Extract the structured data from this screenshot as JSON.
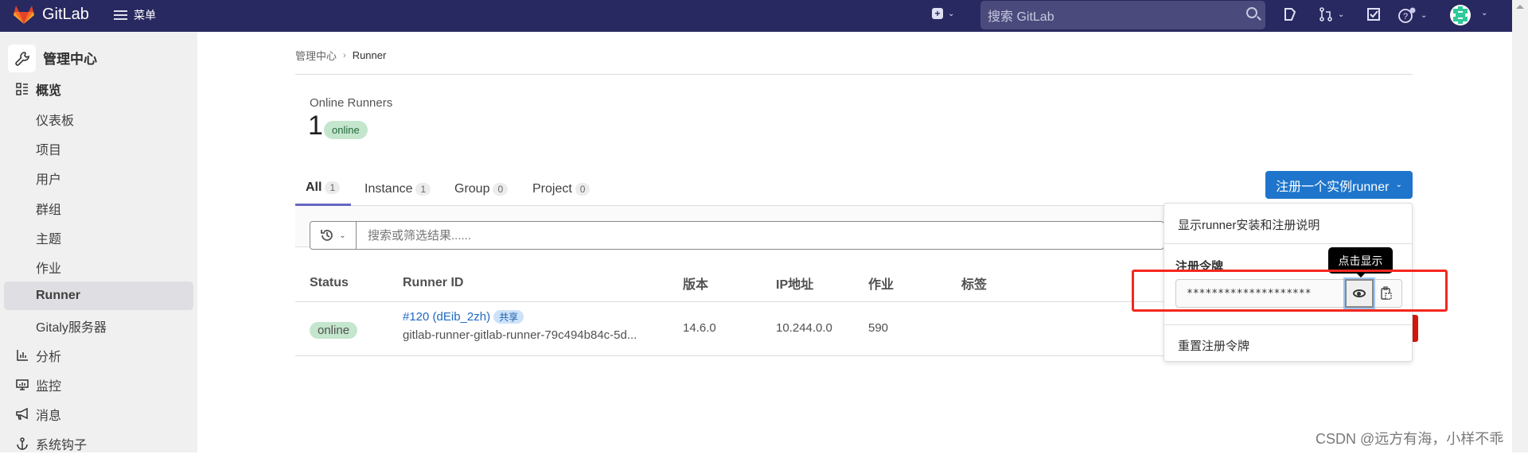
{
  "topbar": {
    "app_name": "GitLab",
    "menu_label": "菜单",
    "search_placeholder": "搜索 GitLab",
    "icons": [
      "plus-square-icon",
      "chevron-down-icon",
      "search-icon",
      "issues-icon",
      "merge-request-icon",
      "todo-icon",
      "help-icon",
      "avatar"
    ]
  },
  "sidebar": {
    "title": "管理中心",
    "sections": [
      {
        "label": "概览",
        "icon": "overview-icon"
      },
      {
        "label": "分析",
        "icon": "analytics-icon"
      },
      {
        "label": "监控",
        "icon": "monitor-icon"
      },
      {
        "label": "消息",
        "icon": "messages-icon"
      },
      {
        "label": "系统钩子",
        "icon": "hook-icon"
      }
    ],
    "items": [
      {
        "label": "仪表板"
      },
      {
        "label": "项目"
      },
      {
        "label": "用户"
      },
      {
        "label": "群组"
      },
      {
        "label": "主题"
      },
      {
        "label": "作业"
      },
      {
        "label": "Runner",
        "active": true
      },
      {
        "label": "Gitaly服务器"
      }
    ]
  },
  "breadcrumb": {
    "parent": "管理中心",
    "separator": "›",
    "current": "Runner"
  },
  "stats": {
    "label": "Online Runners",
    "count": "1",
    "badge": "online"
  },
  "tabs": [
    {
      "label": "All",
      "count": "1",
      "active": true
    },
    {
      "label": "Instance",
      "count": "1"
    },
    {
      "label": "Group",
      "count": "0"
    },
    {
      "label": "Project",
      "count": "0"
    }
  ],
  "filter": {
    "placeholder": "搜索或筛选结果......"
  },
  "table": {
    "columns": [
      "Status",
      "Runner ID",
      "版本",
      "IP地址",
      "作业",
      "标签"
    ],
    "rows": [
      {
        "status": "online",
        "runner_link": "#120 (dEib_2zh)",
        "runner_badge": "共享",
        "runner_desc": "gitlab-runner-gitlab-runner-79c494b84c-5d...",
        "version": "14.6.0",
        "ip": "10.244.0.0",
        "jobs": "590",
        "tags": ""
      }
    ]
  },
  "register": {
    "button_label": "注册一个实例runner",
    "dropdown": {
      "show_instructions": "显示runner安装和注册说明",
      "token_label": "注册令牌",
      "token_masked": "********************",
      "reveal_tooltip": "点击显示",
      "reset_token": "重置注册令牌"
    }
  },
  "colors": {
    "topbar": "#292961",
    "primary_button": "#1f75cb",
    "online_badge_bg": "#c3e6cd",
    "annotation_red": "#f5271f"
  },
  "watermark": "CSDN @远方有海，小样不乖"
}
